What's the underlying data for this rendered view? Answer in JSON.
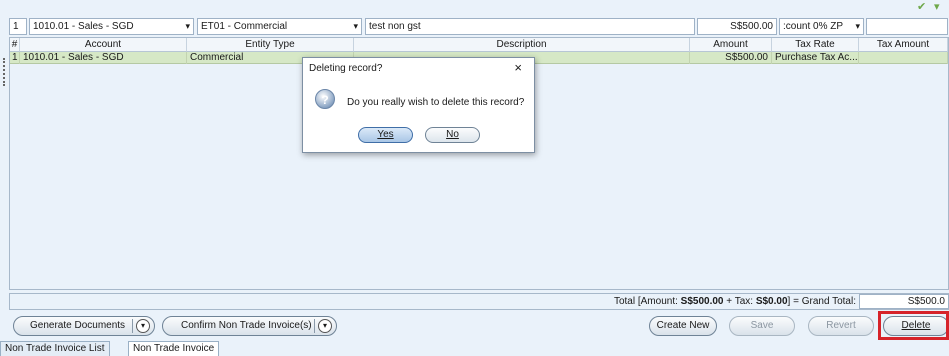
{
  "entry_row": {
    "line_no": "1",
    "account": "1010.01 - Sales - SGD",
    "entity_type": "ET01 - Commercial",
    "description": "test non gst",
    "amount": "S$500.00",
    "tax_rate": ":count 0% ZP"
  },
  "columns": [
    "#",
    "Account",
    "Entity Type",
    "Description",
    "Amount",
    "Tax Rate",
    "Tax Amount"
  ],
  "rows": [
    {
      "no": "1",
      "account": "1010.01 - Sales - SGD",
      "entity_type": "Commercial",
      "description": "",
      "amount": "S$500.00",
      "tax_rate": "Purchase Tax Ac...",
      "tax_amount": ""
    }
  ],
  "totals": {
    "prefix": "Total [Amount: ",
    "amount": "S$500.00",
    "mid": " + Tax: ",
    "tax": "S$0.00",
    "suffix": "] = Grand Total:",
    "grand_total": "S$500.0"
  },
  "buttons": {
    "generate": "Generate Documents",
    "confirm": "Confirm Non Trade Invoice(s)",
    "create_new": "Create New",
    "save": "Save",
    "revert": "Revert",
    "delete": "Delete"
  },
  "tabs": [
    "Non Trade Invoice List",
    "Non Trade Invoice"
  ],
  "dialog": {
    "title": "Deleting record?",
    "close": "×",
    "message": "Do you really wish to delete this record?",
    "yes": "Yes",
    "no": "No"
  },
  "icons": {
    "dropdown": "▾",
    "question": "?"
  },
  "colors": {
    "row_selected": "#d6e8c6",
    "highlight": "#d6232a"
  }
}
